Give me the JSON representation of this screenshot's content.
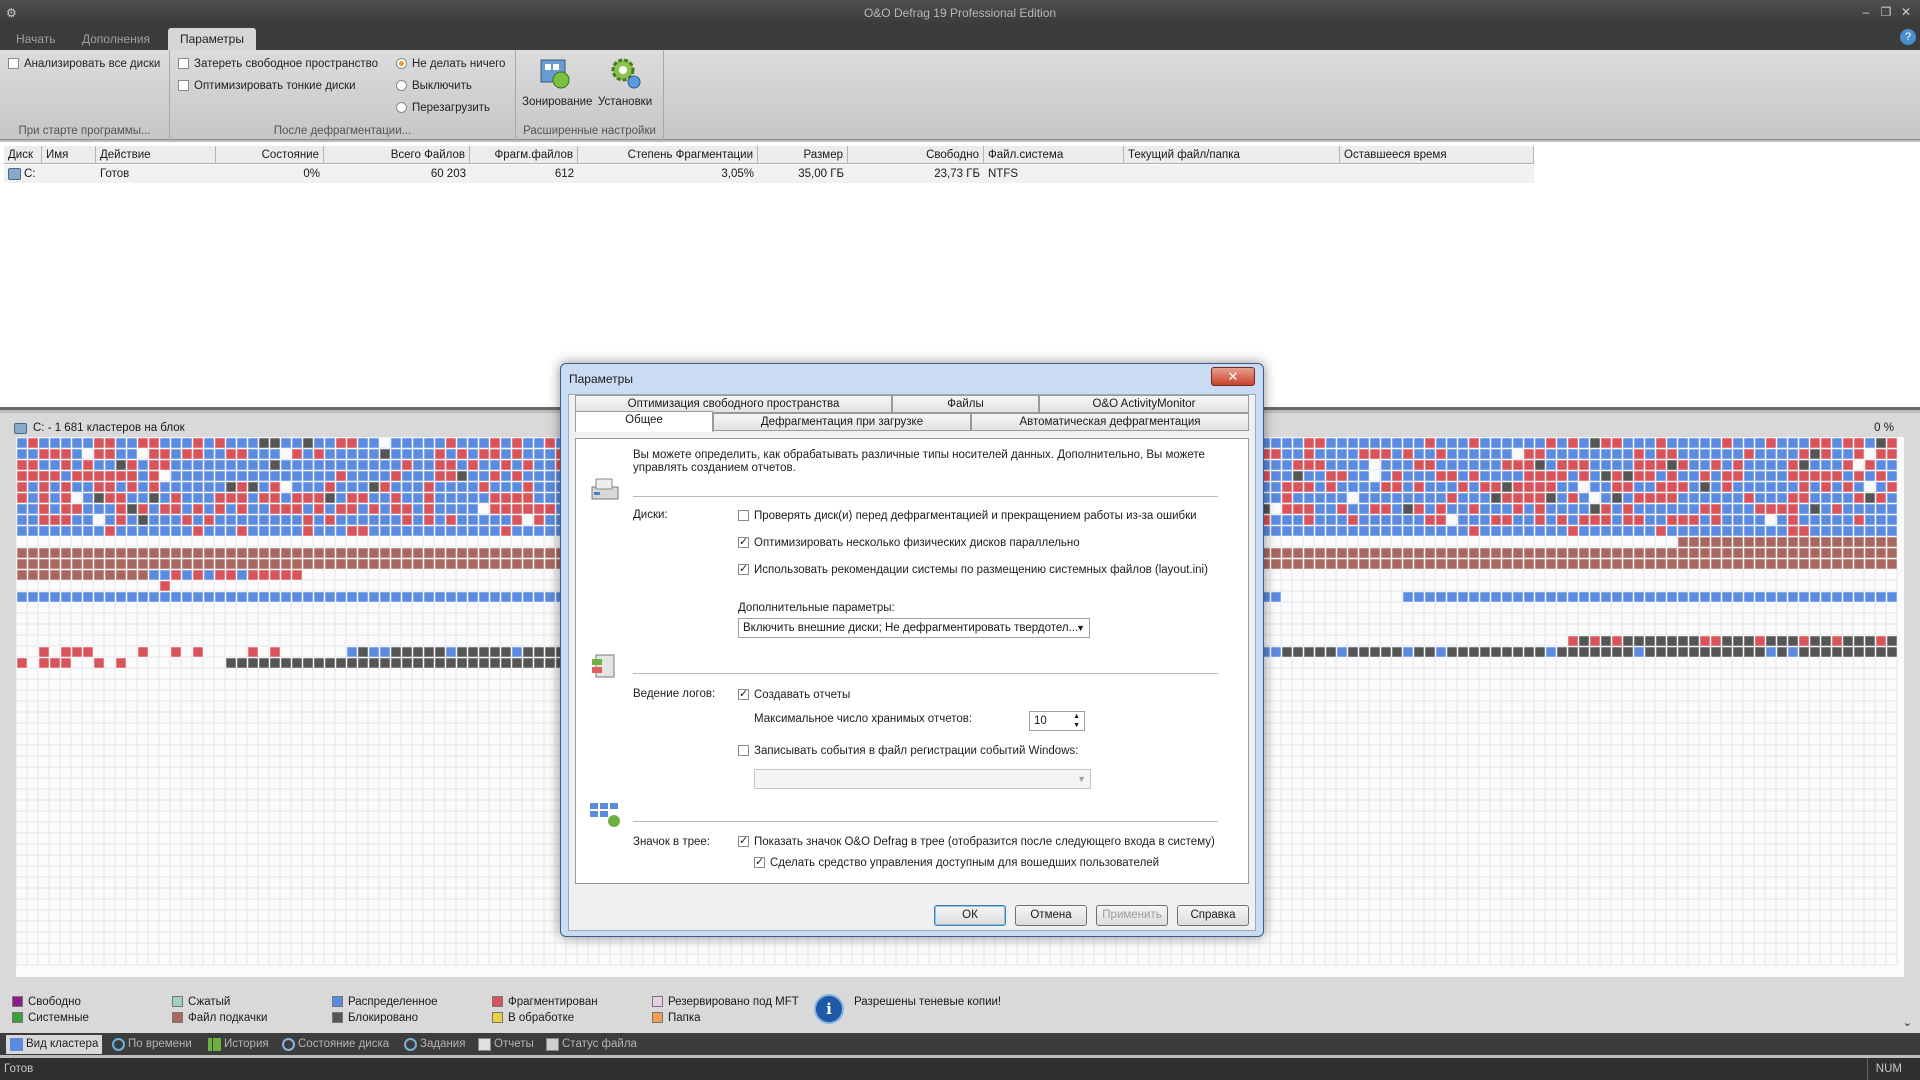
{
  "window": {
    "title": "O&O Defrag 19 Professional Edition"
  },
  "ribbon": {
    "tabs": [
      "Начать",
      "Дополнения",
      "Параметры"
    ],
    "startup": {
      "analyze_all": "Анализировать все диски",
      "group_label": "При старте программы..."
    },
    "after": {
      "wipe_free": "Затереть свободное пространство",
      "optimize_thin": "Оптимизировать тонкие диски",
      "do_nothing": "Не делать ничего",
      "shutdown": "Выключить",
      "restart": "Перезагрузить",
      "group_label": "После дефрагментации..."
    },
    "advanced": {
      "zoning": "Зонирование",
      "settings": "Установки",
      "group_label": "Расширенные настройки"
    }
  },
  "table": {
    "headers": [
      "Диск",
      "Имя",
      "Действие",
      "Состояние",
      "Всего Файлов",
      "Фрагм.файлов",
      "Степень Фрагментации",
      "Размер",
      "Свободно",
      "Файл.система",
      "Текущий файл/папка",
      "Оставшееся время"
    ],
    "row": {
      "disk": "C:",
      "action": "Готов",
      "state": "0%",
      "total_files": "60 203",
      "frag_files": "612",
      "frag_degree": "3,05%",
      "size": "35,00 ГБ",
      "free": "23,73 ГБ",
      "fs": "NTFS"
    }
  },
  "clustermap": {
    "header": "C: - 1 681 кластеров на блок",
    "percent": "0 %"
  },
  "legend": {
    "free": "Свободно",
    "system": "Системные",
    "compressed": "Сжатый",
    "pagefile": "Файл подкачки",
    "allocated": "Распределенное",
    "locked": "Блокировано",
    "fragmented": "Фрагментирован",
    "processing": "В обработке",
    "mft": "Резервировано под MFT",
    "folder": "Папка",
    "shadow": "Разрешены теневые копии!",
    "colors": {
      "free": "#8a1f8a",
      "system": "#3aa03a",
      "compressed": "#9fd0c8",
      "pagefile": "#a86860",
      "allocated": "#5b8be0",
      "locked": "#555555",
      "fragmented": "#d9535a",
      "processing": "#e8d040",
      "mft": "#e8d0e8",
      "folder": "#f0a050"
    }
  },
  "bottom_tabs": [
    "Вид кластера",
    "По времени",
    "История",
    "Состояние диска",
    "Задания",
    "Отчеты",
    "Статус файла"
  ],
  "status": {
    "text": "Готов",
    "num": "NUM"
  },
  "dialog": {
    "title": "Параметры",
    "tabs_top": [
      "Оптимизация свободного пространства",
      "Файлы",
      "O&O ActivityMonitor"
    ],
    "tabs_bottom": [
      "Общее",
      "Дефрагментация при загрузке",
      "Автоматическая дефрагментация"
    ],
    "intro_line1": "Вы можете определить, как обрабатывать различные типы носителей данных. Дополнительно, Вы можете",
    "intro_line2": "управлять созданием отчетов.",
    "disks_label": "Диски:",
    "check_disk": "Проверять диск(и) перед дефрагментацией и прекращением работы из-за ошибки",
    "parallel": "Оптимизировать несколько физических дисков параллельно",
    "layout": "Использовать рекомендации системы по размещению системных файлов (layout.ini)",
    "extra_label": "Дополнительные параметры:",
    "extra_value": "Включить внешние диски; Не дефрагментировать твердотел...",
    "logs_label": "Ведение логов:",
    "create_reports": "Создавать отчеты",
    "max_reports_label": "Максимальное число хранимых отчетов:",
    "max_reports": "10",
    "event_log": "Записывать события в файл регистрации событий Windows:",
    "tray_label": "Значок в трее:",
    "tray_show": "Показать значок O&O Defrag в трее (отобразится после следующего входа в систему)",
    "tray_users": "Сделать средство управления доступным для вошедших пользователей",
    "ok": "ОК",
    "cancel": "Отмена",
    "apply": "Применить",
    "help": "Справка"
  }
}
